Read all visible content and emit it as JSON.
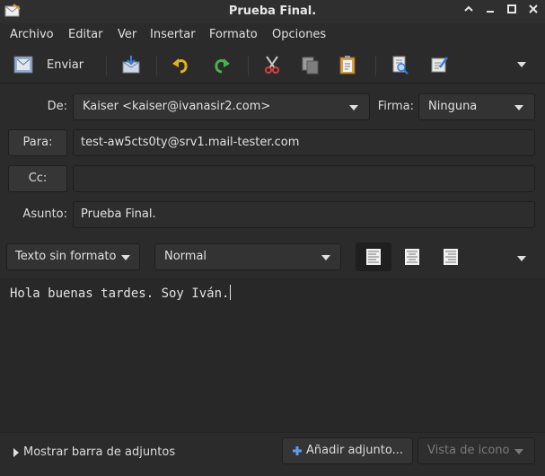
{
  "window": {
    "title": "Prueba Final."
  },
  "menu": {
    "items": [
      "Archivo",
      "Editar",
      "Ver",
      "Insertar",
      "Formato",
      "Opciones"
    ]
  },
  "toolbar": {
    "send_label": "Enviar"
  },
  "header": {
    "from_label": "De:",
    "from_value": "Kaiser <kaiser@ivanasir2.com>",
    "signature_label": "Firma:",
    "signature_value": "Ninguna",
    "to_label": "Para:",
    "to_value": "test-aw5cts0ty@srv1.mail-tester.com",
    "cc_label": "Cc:",
    "cc_value": "",
    "subject_label": "Asunto:",
    "subject_value": "Prueba Final."
  },
  "format": {
    "mode_value": "Texto sin formato",
    "paragraph_value": "Normal",
    "active_alignment": "left"
  },
  "body": {
    "text": "Hola buenas tardes. Soy Iván."
  },
  "attachments": {
    "toggle_label": "Mostrar barra de adjuntos",
    "add_label": "Añadir adjunto...",
    "view_label": "Vista de icono"
  },
  "colors": {
    "background": "#2b2b2b",
    "accent_blue": "#5aa0e6",
    "green_arrow": "#4caf50",
    "yellow_arrow": "#e0b020"
  }
}
